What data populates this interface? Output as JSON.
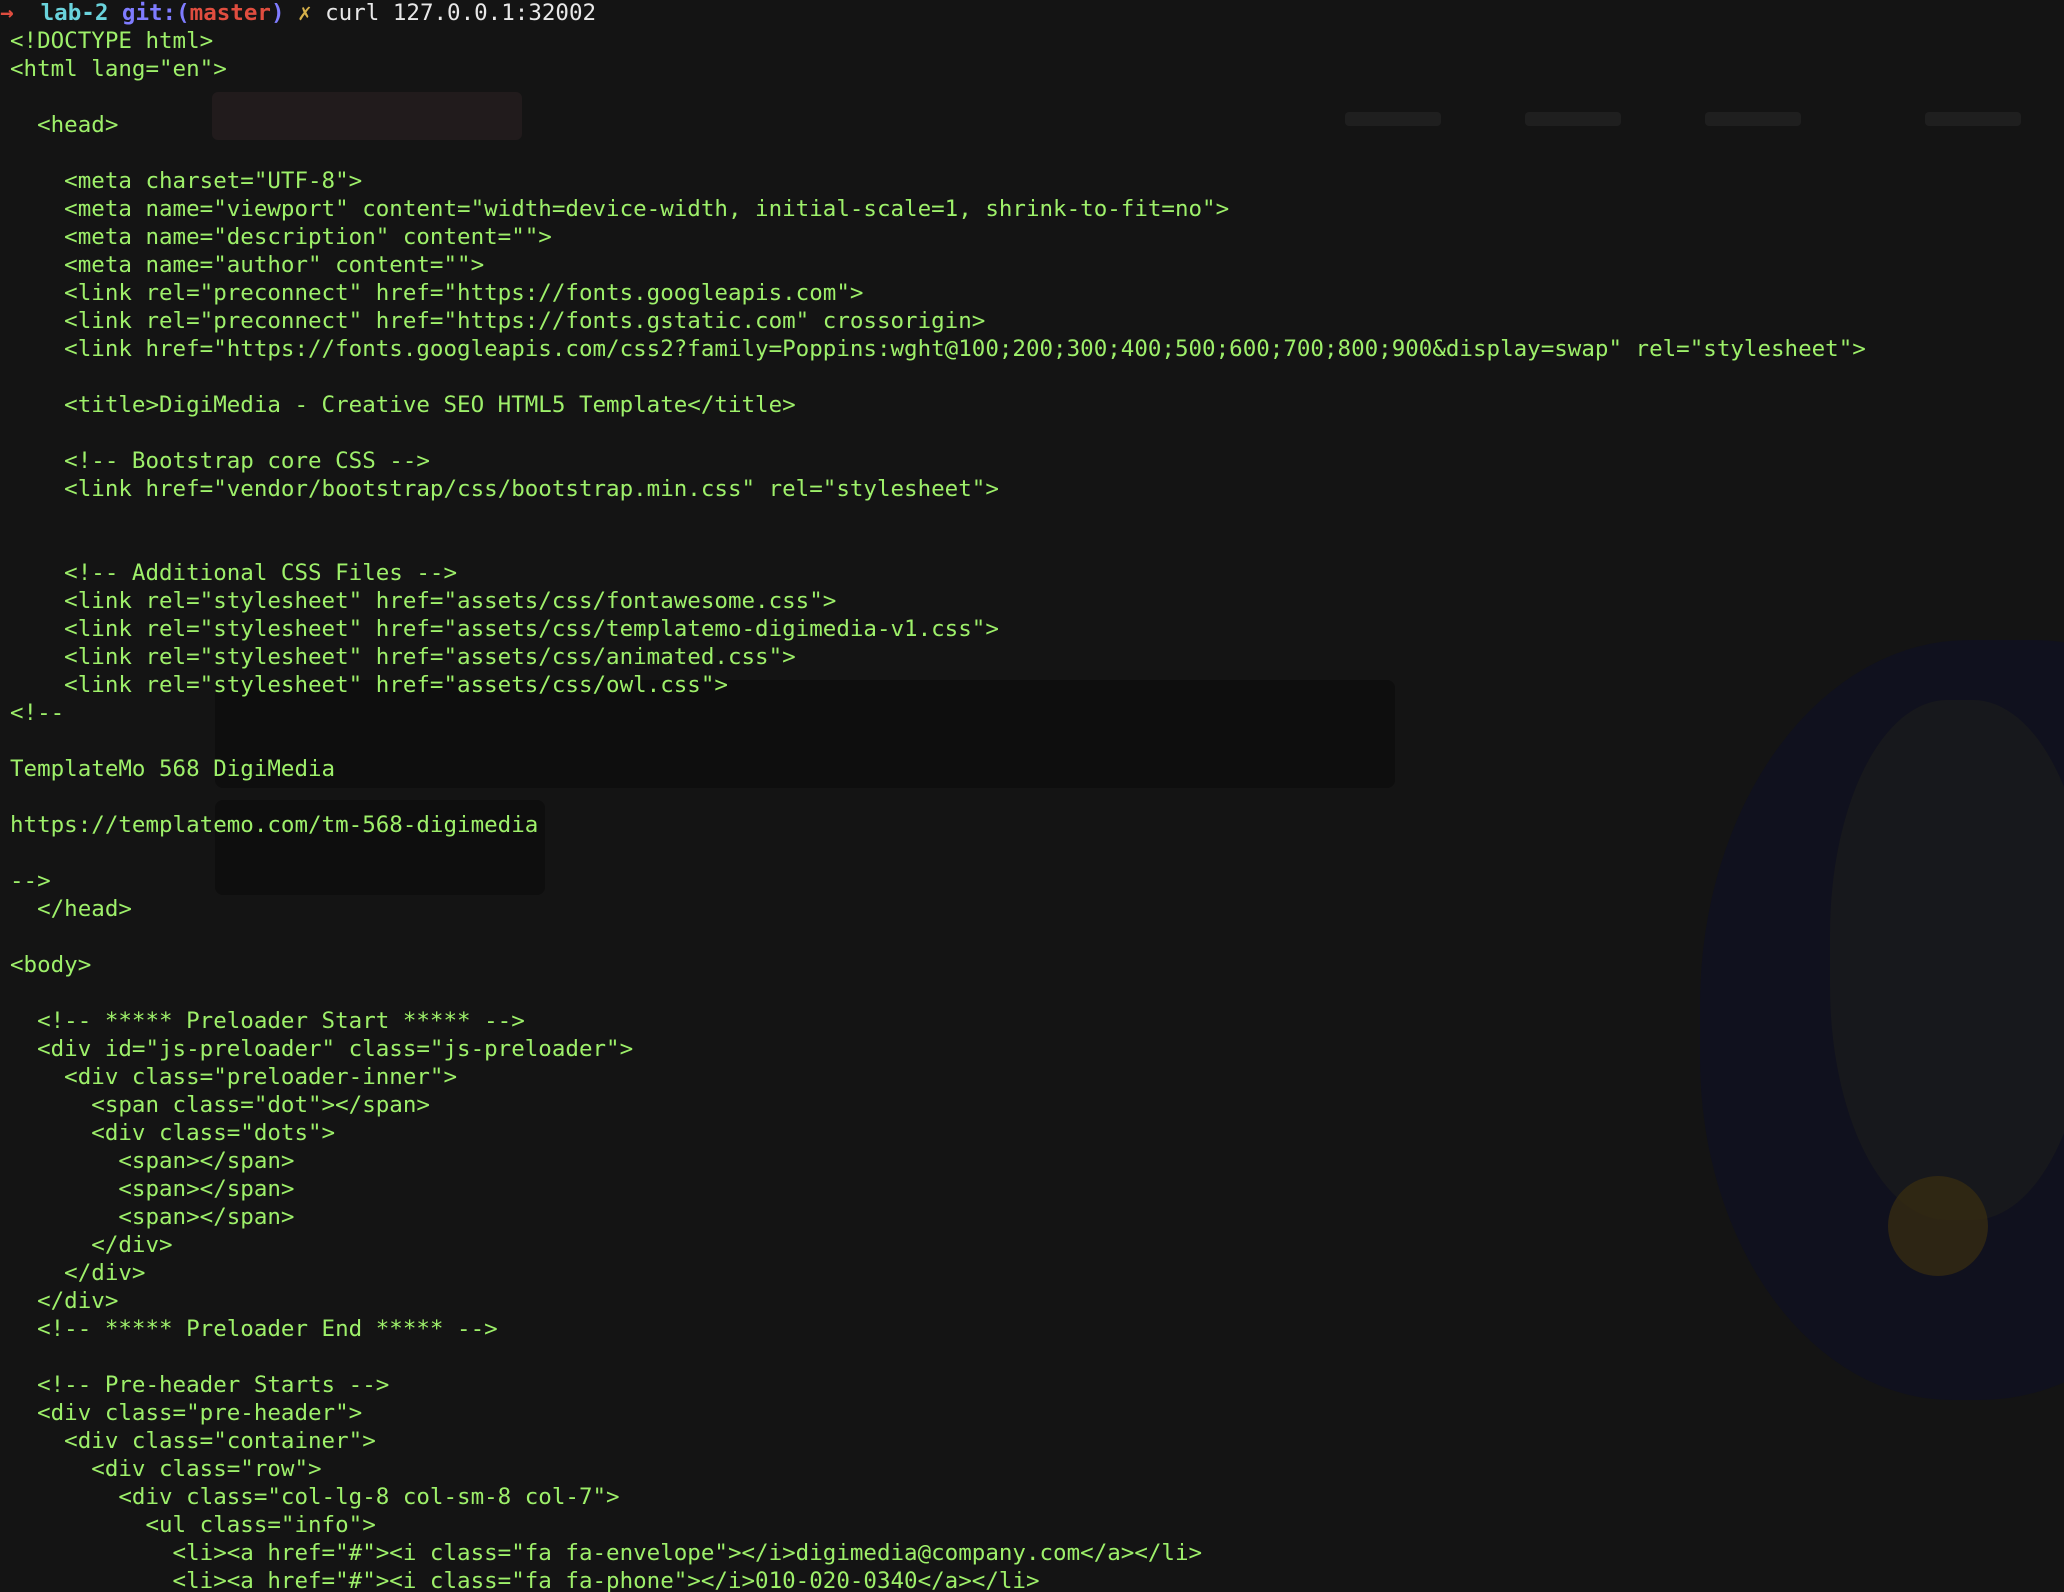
{
  "prompt": {
    "arrow": "→",
    "directory": "lab-2",
    "git_label": "git:(",
    "branch": "master",
    "git_close": ")",
    "dirty_marker": "✗",
    "command": "curl 127.0.0.1:32002"
  },
  "output_lines": [
    "<!DOCTYPE html>",
    "<html lang=\"en\">",
    "",
    "  <head>",
    "",
    "    <meta charset=\"UTF-8\">",
    "    <meta name=\"viewport\" content=\"width=device-width, initial-scale=1, shrink-to-fit=no\">",
    "    <meta name=\"description\" content=\"\">",
    "    <meta name=\"author\" content=\"\">",
    "    <link rel=\"preconnect\" href=\"https://fonts.googleapis.com\">",
    "    <link rel=\"preconnect\" href=\"https://fonts.gstatic.com\" crossorigin>",
    "    <link href=\"https://fonts.googleapis.com/css2?family=Poppins:wght@100;200;300;400;500;600;700;800;900&display=swap\" rel=\"stylesheet\">",
    "",
    "    <title>DigiMedia - Creative SEO HTML5 Template</title>",
    "",
    "    <!-- Bootstrap core CSS -->",
    "    <link href=\"vendor/bootstrap/css/bootstrap.min.css\" rel=\"stylesheet\">",
    "",
    "",
    "    <!-- Additional CSS Files -->",
    "    <link rel=\"stylesheet\" href=\"assets/css/fontawesome.css\">",
    "    <link rel=\"stylesheet\" href=\"assets/css/templatemo-digimedia-v1.css\">",
    "    <link rel=\"stylesheet\" href=\"assets/css/animated.css\">",
    "    <link rel=\"stylesheet\" href=\"assets/css/owl.css\">",
    "<!--",
    "",
    "TemplateMo 568 DigiMedia",
    "",
    "https://templatemo.com/tm-568-digimedia",
    "",
    "-->",
    "  </head>",
    "",
    "<body>",
    "",
    "  <!-- ***** Preloader Start ***** -->",
    "  <div id=\"js-preloader\" class=\"js-preloader\">",
    "    <div class=\"preloader-inner\">",
    "      <span class=\"dot\"></span>",
    "      <div class=\"dots\">",
    "        <span></span>",
    "        <span></span>",
    "        <span></span>",
    "      </div>",
    "    </div>",
    "  </div>",
    "  <!-- ***** Preloader End ***** -->",
    "",
    "  <!-- Pre-header Starts -->",
    "  <div class=\"pre-header\">",
    "    <div class=\"container\">",
    "      <div class=\"row\">",
    "        <div class=\"col-lg-8 col-sm-8 col-7\">",
    "          <ul class=\"info\">",
    "            <li><a href=\"#\"><i class=\"fa fa-envelope\"></i>digimedia@company.com</a></li>",
    "            <li><a href=\"#\"><i class=\"fa fa-phone\"></i>010-020-0340</a></li>"
  ]
}
